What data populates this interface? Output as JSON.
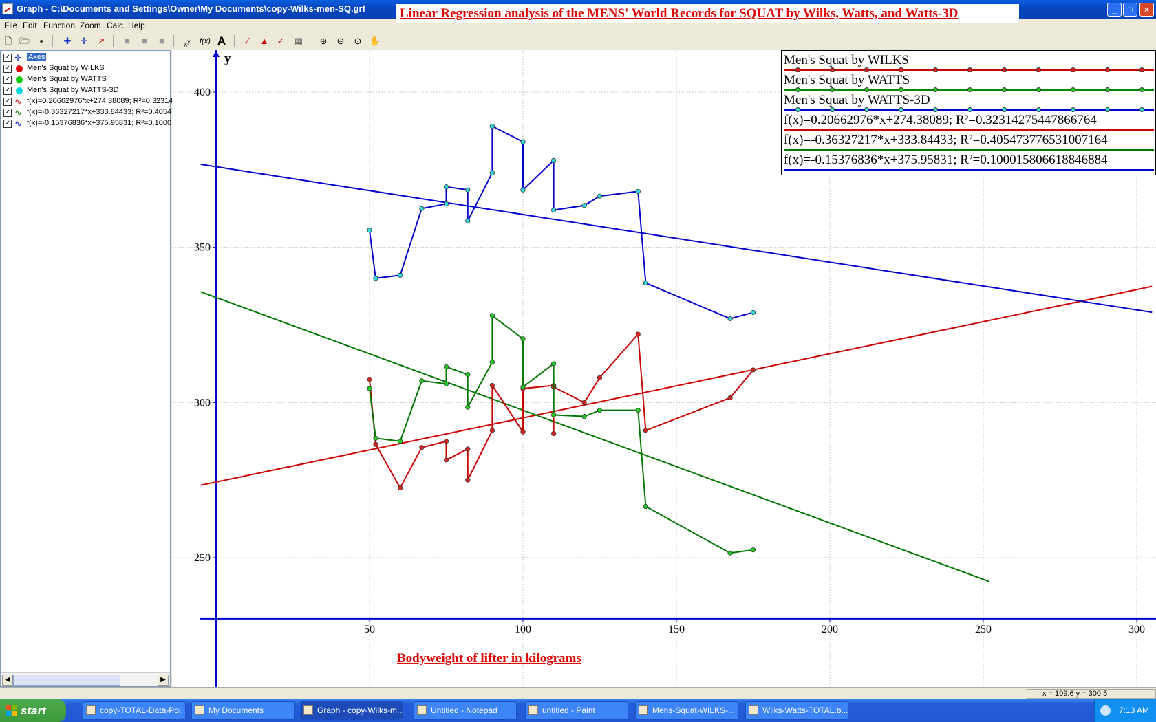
{
  "window": {
    "title": "Graph - C:\\Documents and Settings\\Owner\\My Documents\\copy-Wilks-men-SQ.grf",
    "banner": "Linear Regression analysis of the MENS' World Records for SQUAT by Wilks, Watts, and Watts-3D",
    "buttons": {
      "minimize": "_",
      "maximize": "□",
      "close": "×"
    }
  },
  "menu": [
    "File",
    "Edit",
    "Function",
    "Zoom",
    "Calc",
    "Help"
  ],
  "toolbar": {
    "text_button": "A"
  },
  "function_list": [
    {
      "label": "Axes",
      "checked": true,
      "selected": true,
      "icon": "axes-icon"
    },
    {
      "label": "Men's Squat by WILKS",
      "checked": true,
      "icon": "red-dot-icon",
      "color": "#e00000"
    },
    {
      "label": "Men's Squat by WATTS",
      "checked": true,
      "icon": "green-dot-icon",
      "color": "#00cc00"
    },
    {
      "label": "Men's Squat by WATTS-3D",
      "checked": true,
      "icon": "cyan-dot-icon",
      "color": "#00d8e0"
    },
    {
      "label": "f(x)=0.20662976*x+274.38089; R²=0.32314",
      "checked": true,
      "icon": "red-curve-icon",
      "color": "#cc0000"
    },
    {
      "label": "f(x)=-0.36327217*x+333.84433; R²=0.4054",
      "checked": true,
      "icon": "green-curve-icon",
      "color": "#007700"
    },
    {
      "label": "f(x)=-0.15376836*x+375.95831; R²=0.1000",
      "checked": true,
      "icon": "blue-curve-icon",
      "color": "#0000cc"
    }
  ],
  "legend": [
    {
      "text": "Men's Squat by WILKS",
      "color": "#cc0000",
      "dot": "#dd2222"
    },
    {
      "text": "Men's Squat by WATTS",
      "color": "#008800",
      "dot": "#22cc22"
    },
    {
      "text": "Men's Squat by WATTS-3D",
      "color": "#0000cc",
      "dot": "#33dddd"
    },
    {
      "text": "f(x)=0.20662976*x+274.38089; R²=0.32314275447866764",
      "color": "#cc0000"
    },
    {
      "text": "f(x)=-0.36327217*x+333.84433; R²=0.40547377653100716​4",
      "color": "#007700"
    },
    {
      "text": "f(x)=-0.15376836*x+375.95831; R²=0.1000158066188468​84",
      "color": "#0000cc"
    }
  ],
  "plot": {
    "y_axis_label": "y",
    "x_caption": "Bodyweight  of  lifter  in  kilograms"
  },
  "chart_data": {
    "type": "line",
    "xlim": [
      -5,
      305
    ],
    "ylim": [
      230,
      415
    ],
    "xticks": [
      50,
      100,
      150,
      200,
      250,
      300
    ],
    "yticks": [
      250,
      300,
      350,
      400
    ],
    "grid": true,
    "series": [
      {
        "name": "Men's Squat by WILKS",
        "color": "#cc0000",
        "marker": "#dd2222",
        "x": [
          50,
          52,
          60,
          67,
          75,
          75,
          82,
          82,
          90,
          90,
          100,
          100,
          110,
          110,
          110,
          120,
          125,
          137.5,
          140,
          167.5,
          175
        ],
        "y": [
          307.5,
          286.5,
          272.5,
          285.5,
          287.5,
          281.5,
          285,
          275,
          291,
          305.5,
          290.5,
          304.5,
          305.5,
          290,
          305,
          300,
          308,
          322,
          291,
          301.5,
          310.5
        ]
      },
      {
        "name": "Men's Squat by WATTS",
        "color": "#007700",
        "marker": "#22cc22",
        "x": [
          50,
          52,
          60,
          67,
          75,
          75,
          82,
          82,
          90,
          90,
          100,
          100,
          110,
          110,
          120,
          125,
          137.5,
          140,
          167.5,
          175
        ],
        "y": [
          304.5,
          288.5,
          287.5,
          307,
          306,
          311.5,
          309,
          298.5,
          313,
          328,
          320.5,
          305,
          312.5,
          296,
          295.5,
          297.5,
          297.5,
          266.5,
          251.5,
          252.5
        ]
      },
      {
        "name": "Men's Squat by WATTS-3D",
        "color": "#0000cc",
        "marker": "#33dddd",
        "x": [
          50,
          52,
          60,
          67,
          75,
          75,
          82,
          82,
          90,
          90,
          100,
          100,
          110,
          110,
          120,
          125,
          137.5,
          140,
          167.5,
          175
        ],
        "y": [
          355.5,
          340,
          341,
          362.5,
          364,
          369.5,
          368.5,
          358.5,
          374,
          389,
          384,
          368.5,
          378,
          362,
          363.5,
          366.5,
          368,
          338.5,
          327,
          329
        ]
      }
    ],
    "regression_lines": [
      {
        "slope": 0.20662976,
        "intercept": 274.38089,
        "color": "#cc0000",
        "x_range": [
          -5,
          305
        ]
      },
      {
        "slope": -0.36327217,
        "intercept": 333.84433,
        "color": "#007700",
        "x_range": [
          -5,
          252
        ]
      },
      {
        "slope": -0.15376836,
        "intercept": 375.95831,
        "color": "#0000cc",
        "x_range": [
          -5,
          305
        ]
      }
    ]
  },
  "status": {
    "coords": "x = 109.6    y = 300.5"
  },
  "taskbar": {
    "start": "start",
    "tasks": [
      {
        "label": "copy-TOTAL-Data-Poi...",
        "active": false
      },
      {
        "label": "My Documents",
        "active": false
      },
      {
        "label": "Graph - copy-Wilks-m...",
        "active": true
      },
      {
        "label": "Untitled - Notepad",
        "active": false
      },
      {
        "label": "untitled - Paint",
        "active": false
      },
      {
        "label": "Mens-Squat-WILKS-...",
        "active": false
      },
      {
        "label": "Wilks-Watts-TOTAL.b...",
        "active": false
      }
    ],
    "clock": "7:13 AM"
  }
}
